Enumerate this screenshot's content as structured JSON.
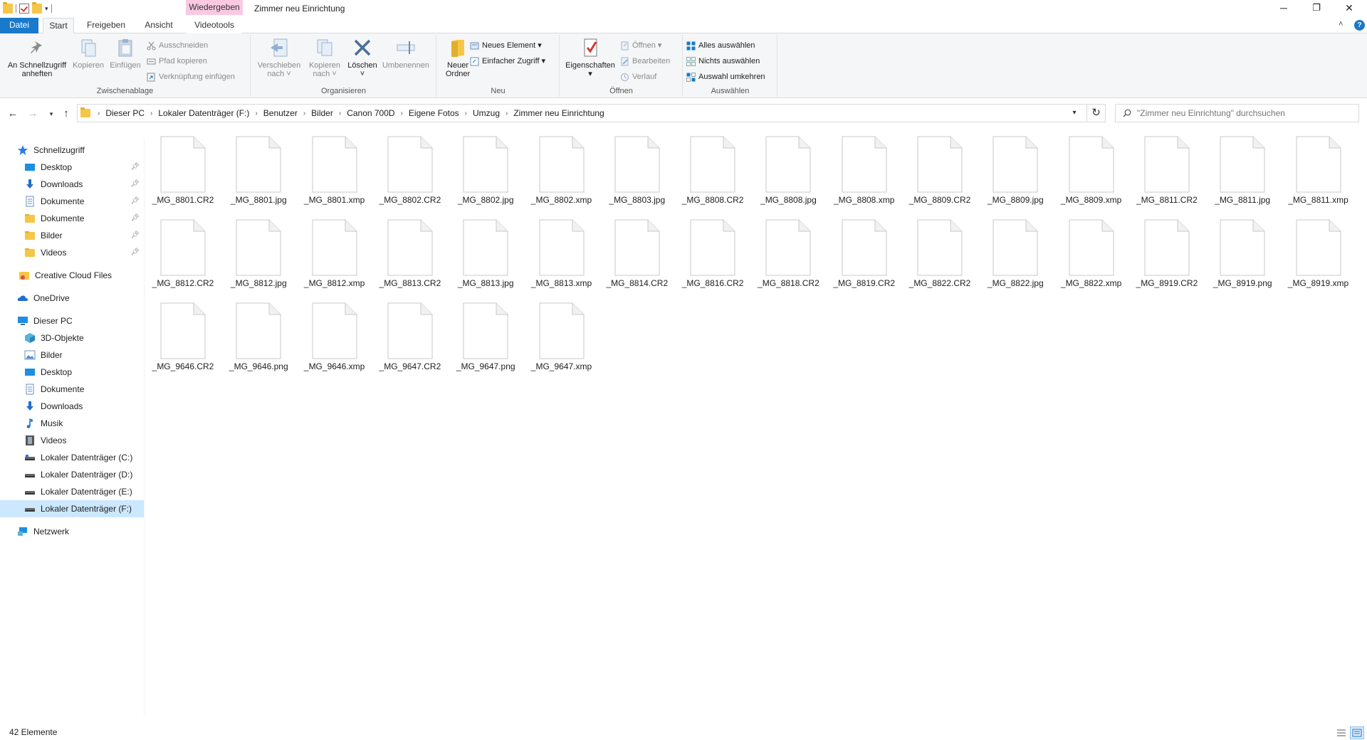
{
  "window": {
    "title": "Zimmer neu Einrichtung",
    "context_tab_group": "Wiedergeben",
    "minimize": "─",
    "restore": "❐",
    "close": "✕"
  },
  "ribbon_tabs": {
    "file": "Datei",
    "home": "Start",
    "share": "Freigeben",
    "view": "Ansicht",
    "video_tools": "Videotools"
  },
  "ribbon": {
    "clipboard": {
      "label": "Zwischenablage",
      "pin": "An Schnellzugriff\nanheften",
      "copy": "Kopieren",
      "paste": "Einfügen",
      "cut": "Ausschneiden",
      "copy_path": "Pfad kopieren",
      "paste_shortcut": "Verknüpfung einfügen"
    },
    "organize": {
      "label": "Organisieren",
      "move_to": "Verschieben\nnach ˅",
      "copy_to": "Kopieren\nnach ˅",
      "delete": "Löschen\n˅",
      "rename": "Umbenennen"
    },
    "new": {
      "label": "Neu",
      "new_folder": "Neuer\nOrdner",
      "new_item": "Neues Element ▾",
      "easy_access": "Einfacher Zugriff ▾"
    },
    "open": {
      "label": "Öffnen",
      "properties": "Eigenschaften\n▾",
      "open": "Öffnen ▾",
      "edit": "Bearbeiten",
      "history": "Verlauf"
    },
    "select": {
      "label": "Auswählen",
      "select_all": "Alles auswählen",
      "select_none": "Nichts auswählen",
      "invert": "Auswahl umkehren"
    }
  },
  "address": {
    "breadcrumbs": [
      "Dieser PC",
      "Lokaler Datenträger (F:)",
      "Benutzer",
      "Bilder",
      "Canon 700D",
      "Eigene Fotos",
      "Umzug",
      "Zimmer neu Einrichtung"
    ],
    "search_placeholder": "\"Zimmer neu Einrichtung\" durchsuchen"
  },
  "nav": {
    "quick_access": "Schnellzugriff",
    "quick_items": [
      "Desktop",
      "Downloads",
      "Dokumente",
      "Dokumente",
      "Bilder",
      "Videos"
    ],
    "creative_cloud": "Creative Cloud Files",
    "onedrive": "OneDrive",
    "this_pc": "Dieser PC",
    "pc_items": [
      "3D-Objekte",
      "Bilder",
      "Desktop",
      "Dokumente",
      "Downloads",
      "Musik",
      "Videos",
      "Lokaler Datenträger (C:)",
      "Lokaler Datenträger (D:)",
      "Lokaler Datenträger (E:)",
      "Lokaler Datenträger (F:)"
    ],
    "network": "Netzwerk"
  },
  "files": [
    "_MG_8801.CR2",
    "_MG_8801.jpg",
    "_MG_8801.xmp",
    "_MG_8802.CR2",
    "_MG_8802.jpg",
    "_MG_8802.xmp",
    "_MG_8803.jpg",
    "_MG_8808.CR2",
    "_MG_8808.jpg",
    "_MG_8808.xmp",
    "_MG_8809.CR2",
    "_MG_8809.jpg",
    "_MG_8809.xmp",
    "_MG_8811.CR2",
    "_MG_8811.jpg",
    "_MG_8811.xmp",
    "_MG_8812.CR2",
    "_MG_8812.jpg",
    "_MG_8812.xmp",
    "_MG_8813.CR2",
    "_MG_8813.jpg",
    "_MG_8813.xmp",
    "_MG_8814.CR2",
    "_MG_8816.CR2",
    "_MG_8818.CR2",
    "_MG_8819.CR2",
    "_MG_8822.CR2",
    "_MG_8822.jpg",
    "_MG_8822.xmp",
    "_MG_8919.CR2",
    "_MG_8919.png",
    "_MG_8919.xmp",
    "_MG_9646.CR2",
    "_MG_9646.png",
    "_MG_9646.xmp",
    "_MG_9647.CR2",
    "_MG_9647.png",
    "_MG_9647.xmp"
  ],
  "status": {
    "count": "42 Elemente"
  },
  "colors": {
    "accent": "#1979ca",
    "selection": "#cce8ff",
    "context_tab": "#f9c9e2",
    "folder": "#f5c748"
  }
}
